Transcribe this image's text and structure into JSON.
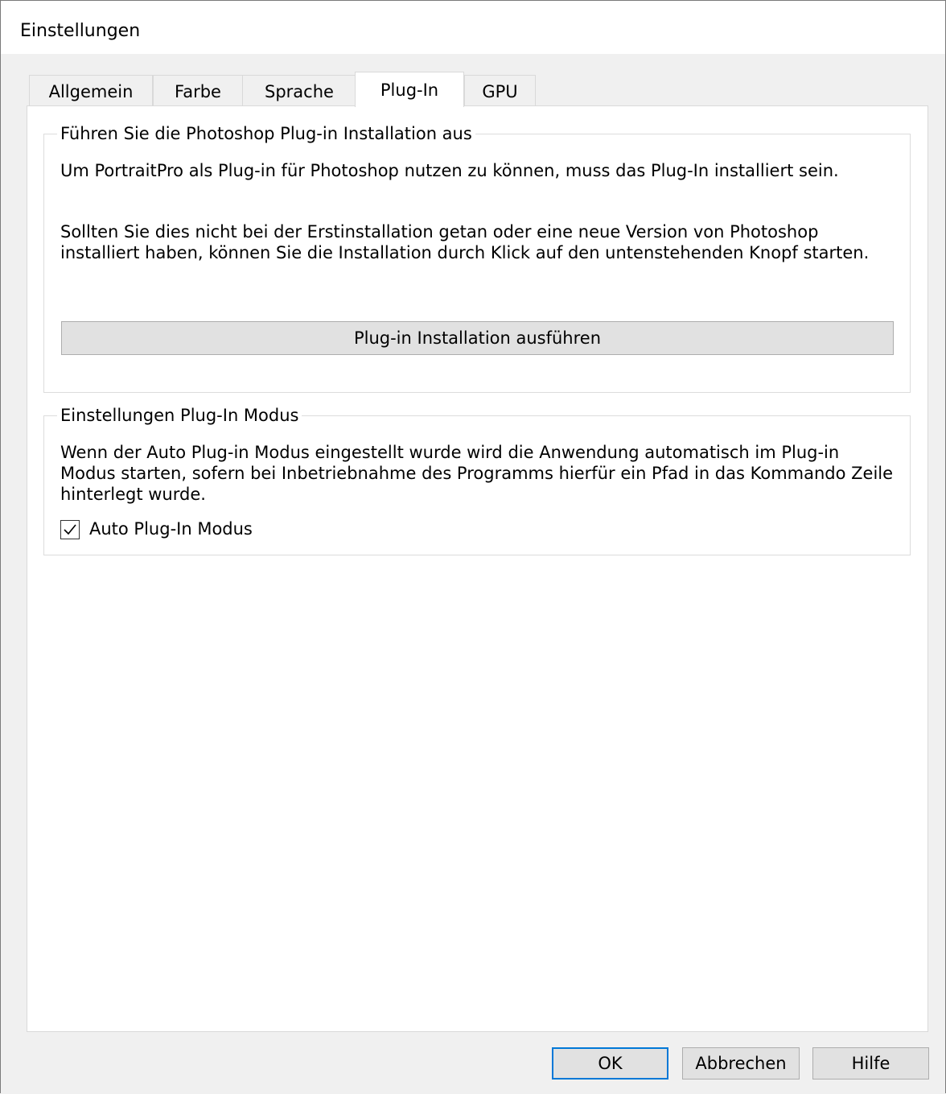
{
  "window": {
    "title": "Einstellungen"
  },
  "tabs": [
    {
      "label": "Allgemein",
      "active": false
    },
    {
      "label": "Farbe",
      "active": false
    },
    {
      "label": "Sprache",
      "active": false
    },
    {
      "label": "Plug-In",
      "active": true
    },
    {
      "label": "GPU",
      "active": false
    }
  ],
  "install_group": {
    "title": "Führen Sie die Photoshop Plug-in Installation aus",
    "paragraph1": "Um PortraitPro als Plug-in für Photoshop nutzen zu können, muss das Plug-In installiert sein.",
    "paragraph2": "Sollten Sie dies nicht bei der Erstinstallation getan oder eine neue Version von Photoshop installiert haben, können Sie die Installation durch Klick auf den untenstehenden Knopf starten.",
    "button_label": "Plug-in Installation ausführen"
  },
  "mode_group": {
    "title": "Einstellungen Plug-In Modus",
    "description": "Wenn der Auto Plug-in Modus eingestellt wurde wird die Anwendung automatisch im Plug-in Modus starten, sofern bei Inbetriebnahme des Programms hierfür ein Pfad in das Kommando Zeile hinterlegt wurde.",
    "checkbox_label": "Auto Plug-In Modus",
    "checkbox_checked": true
  },
  "footer": {
    "ok_label": "OK",
    "cancel_label": "Abbrechen",
    "help_label": "Hilfe"
  },
  "colors": {
    "dialog_background": "#f0f0f0",
    "panel_background": "#ffffff",
    "button_face": "#e1e1e1",
    "default_button_border": "#0078d7"
  },
  "icons": {
    "checkbox": "checkmark-icon"
  }
}
